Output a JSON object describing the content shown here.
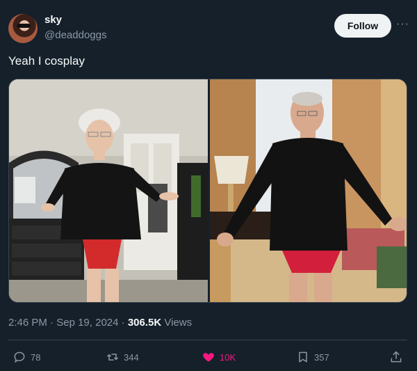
{
  "author": {
    "name": "sky",
    "handle": "@deaddoggs"
  },
  "follow_label": "Follow",
  "more_label": "···",
  "tweet_text": "Yeah I cosplay",
  "meta": {
    "time": "2:46 PM",
    "separator1": " · ",
    "date": "Sep 19, 2024",
    "separator2": " · ",
    "views_count": "306.5K",
    "views_label": " Views"
  },
  "actions": {
    "replies": "78",
    "reposts": "344",
    "likes": "10K",
    "bookmarks": "357"
  },
  "colors": {
    "background": "#15202b",
    "like_active": "#f91880",
    "muted": "#8b98a5"
  },
  "icons": {
    "reply": "reply-icon",
    "repost": "repost-icon",
    "like": "heart-icon",
    "bookmark": "bookmark-icon",
    "share": "share-icon"
  }
}
